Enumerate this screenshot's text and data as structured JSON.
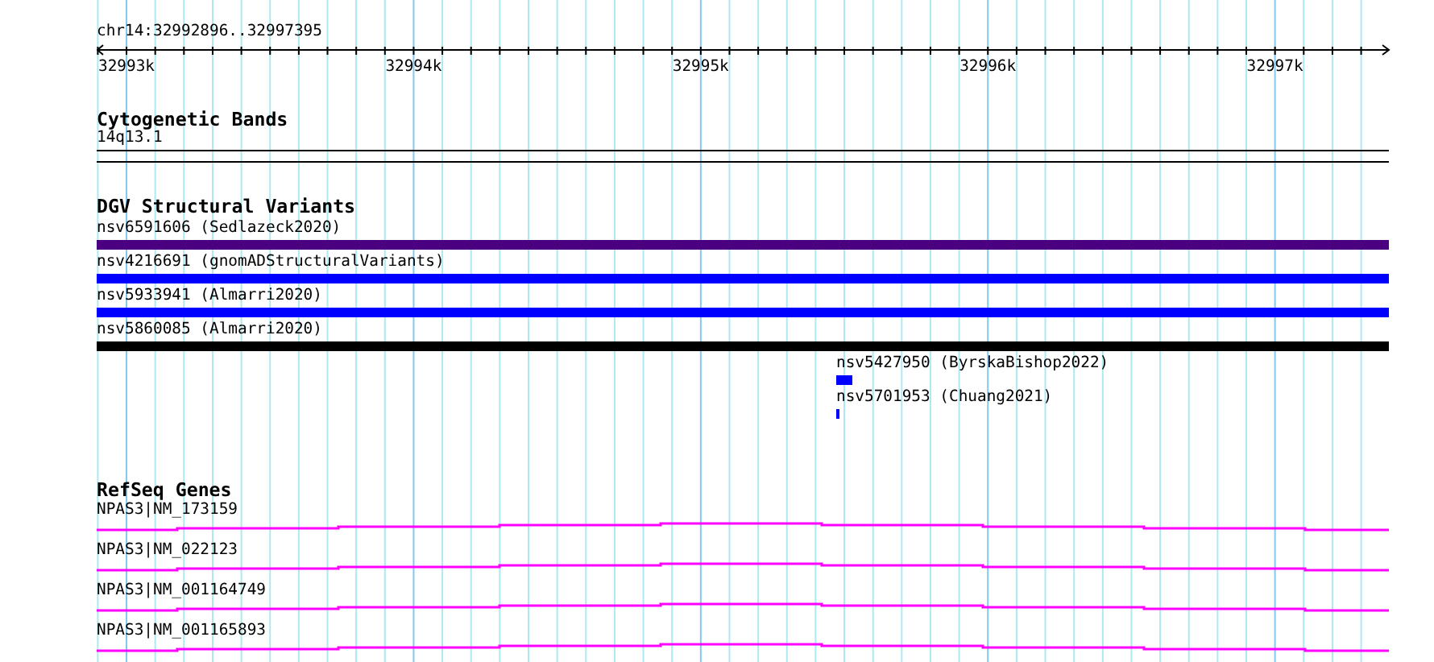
{
  "ruler": {
    "location": "chr14:32992896..32997395",
    "tick_labels": [
      "32993k",
      "32994k",
      "32995k",
      "32996k",
      "32997k"
    ]
  },
  "tracks": [
    {
      "kind": "bands",
      "title": "Cytogenetic Bands",
      "features": [
        {
          "label": "14q13.1"
        }
      ]
    },
    {
      "kind": "variants",
      "title": "DGV Structural Variants",
      "features": [
        {
          "label": "nsv6591606 (Sedlazeck2020)",
          "kind": "full",
          "color": "#4b0082"
        },
        {
          "label": "nsv4216691 (gnomADStructuralVariants)",
          "kind": "full",
          "color": "#0000ff"
        },
        {
          "label": "nsv5933941 (Almarri2020)",
          "kind": "full",
          "color": "#0000ff"
        },
        {
          "label": "nsv5860085 (Almarri2020)",
          "kind": "full",
          "color": "#000000"
        },
        {
          "label": "nsv5427950 (ByrskaBishop2022)",
          "kind": "short",
          "color": "#0000ff"
        },
        {
          "label": "nsv5701953 (Chuang2021)",
          "kind": "tiny",
          "color": "#0000ff"
        }
      ]
    },
    {
      "kind": "genes",
      "title": "RefSeq Genes",
      "features": [
        {
          "label": "NPAS3|NM_173159"
        },
        {
          "label": "NPAS3|NM_022123"
        },
        {
          "label": "NPAS3|NM_001164749"
        },
        {
          "label": "NPAS3|NM_001165893"
        }
      ]
    }
  ]
}
